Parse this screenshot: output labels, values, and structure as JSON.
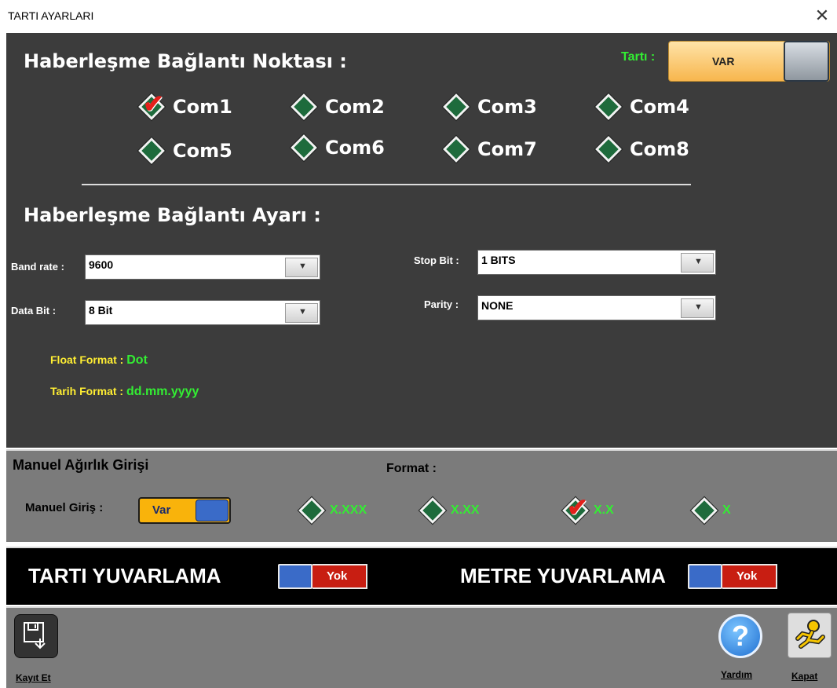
{
  "window": {
    "title": "TARTI AYARLARI",
    "close_glyph": "✕"
  },
  "top": {
    "comm_point_title": "Haberleşme Bağlantı Noktası :",
    "tarti_label": "Tartı :",
    "tarti_toggle_label": "VAR",
    "ports": [
      {
        "label": "Com1",
        "checked": true
      },
      {
        "label": "Com2",
        "checked": false
      },
      {
        "label": "Com3",
        "checked": false
      },
      {
        "label": "Com4",
        "checked": false
      },
      {
        "label": "Com5",
        "checked": false
      },
      {
        "label": "Com6",
        "checked": false
      },
      {
        "label": "Com7",
        "checked": false
      },
      {
        "label": "Com8",
        "checked": false
      }
    ],
    "comm_settings_title": "Haberleşme Bağlantı Ayarı :",
    "band_rate_label": "Band rate :",
    "band_rate_value": "9600",
    "data_bit_label": "Data Bit :",
    "data_bit_value": "8 Bit",
    "stop_bit_label": "Stop Bit :",
    "stop_bit_value": "1 BITS",
    "parity_label": "Parity :",
    "parity_value": "NONE",
    "float_format_label": "Float Format :",
    "float_format_value": "Dot",
    "date_format_label": "Tarih Format :",
    "date_format_value": "dd.mm.yyyy"
  },
  "manual": {
    "title": "Manuel  Ağırlık Girişi",
    "format_label": "Format :",
    "entry_label": "Manuel Giriş :",
    "entry_toggle_label": "Var",
    "formats": [
      {
        "label": "X.XXX",
        "checked": false
      },
      {
        "label": "X.XX",
        "checked": false
      },
      {
        "label": "X.X",
        "checked": true
      },
      {
        "label": "X",
        "checked": false
      }
    ]
  },
  "rounding": {
    "tarti_label": "TARTI YUVARLAMA",
    "tarti_toggle": "Yok",
    "metre_label": "METRE YUVARLAMA",
    "metre_toggle": "Yok"
  },
  "footer": {
    "save_label": "Kayıt Et",
    "help_label": "Yardım",
    "help_glyph": "?",
    "close_label": "Kapat"
  },
  "colors": {
    "panel_dark": "#3c3c3c",
    "panel_gray": "#7b7b7b",
    "accent_green": "#33ee33",
    "accent_yellow": "#ffee33",
    "toggle_orange": "#f9b30b",
    "toggle_red": "#c81e12",
    "toggle_blue": "#3a6bc8"
  },
  "icons": {
    "save": "floppy-disk-icon",
    "help": "question-icon",
    "exit": "running-man-icon",
    "check": "red-check-icon",
    "radio": "green-diamond-icon"
  }
}
